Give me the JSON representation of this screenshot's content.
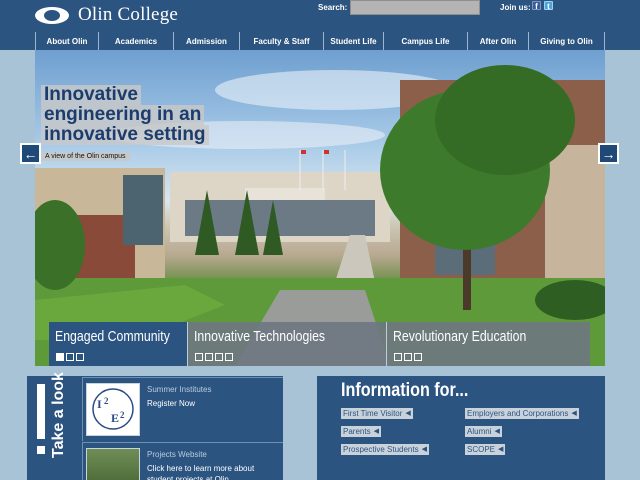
{
  "header": {
    "logo_text": "Olin College",
    "search_label": "Search:",
    "search_value": "",
    "joinus_label": "Join us:",
    "social": [
      {
        "name": "facebook-icon",
        "glyph": "f"
      },
      {
        "name": "twitter-icon",
        "glyph": "t"
      }
    ]
  },
  "nav": {
    "items": [
      {
        "label": "About Olin"
      },
      {
        "label": "Academics"
      },
      {
        "label": "Admission"
      },
      {
        "label": "Faculty & Staff"
      },
      {
        "label": "Student Life"
      },
      {
        "label": "Campus Life"
      },
      {
        "label": "After Olin"
      },
      {
        "label": "Giving to Olin"
      }
    ]
  },
  "hero": {
    "headline_lines": [
      "Innovative",
      "engineering in an",
      "innovative setting"
    ],
    "caption": "A view of the Olin campus",
    "prev_glyph": "←",
    "next_glyph": "→"
  },
  "tabs": [
    {
      "label": "Engaged Community",
      "active": true,
      "dots": 3,
      "active_dot": 1
    },
    {
      "label": "Innovative Technologies",
      "active": false,
      "dots": 4,
      "active_dot": 0
    },
    {
      "label": "Revolutionary Education",
      "active": false,
      "dots": 3,
      "active_dot": 0
    }
  ],
  "take_a_look": {
    "heading": "Take a look",
    "cards": [
      {
        "title": "Summer Institutes",
        "subtitle": "Register Now",
        "thumb_text": "I2E2"
      },
      {
        "title": "Projects Website",
        "subtitle": "Click here to learn more about student projects at Olin"
      }
    ]
  },
  "information_for": {
    "title": "Information for...",
    "links": [
      {
        "label": "First Time Visitor"
      },
      {
        "label": "Employers and Corporations"
      },
      {
        "label": "Parents"
      },
      {
        "label": "Alumni"
      },
      {
        "label": "Prospective Students"
      },
      {
        "label": "SCOPE"
      }
    ]
  },
  "colors": {
    "brand_blue": "#2c5480",
    "page_bg": "#a9c3d6",
    "link_bg": "#c9d2db"
  }
}
